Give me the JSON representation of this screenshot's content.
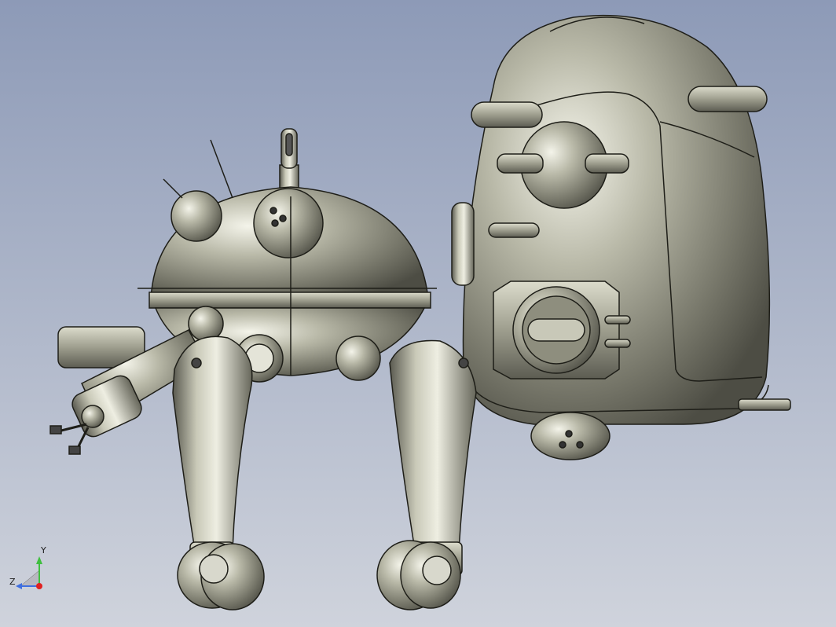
{
  "viewport": {
    "background_top": "#8d9ab7",
    "background_bottom": "#cfd3dc",
    "model_color": "#8e8e7e",
    "edge_color": "#1e1e18"
  },
  "triad": {
    "y_label": "Y",
    "z_label": "Z",
    "y_color": "#3fbf3f",
    "z_color": "#3f6fe0",
    "x_color": "#e02020"
  }
}
